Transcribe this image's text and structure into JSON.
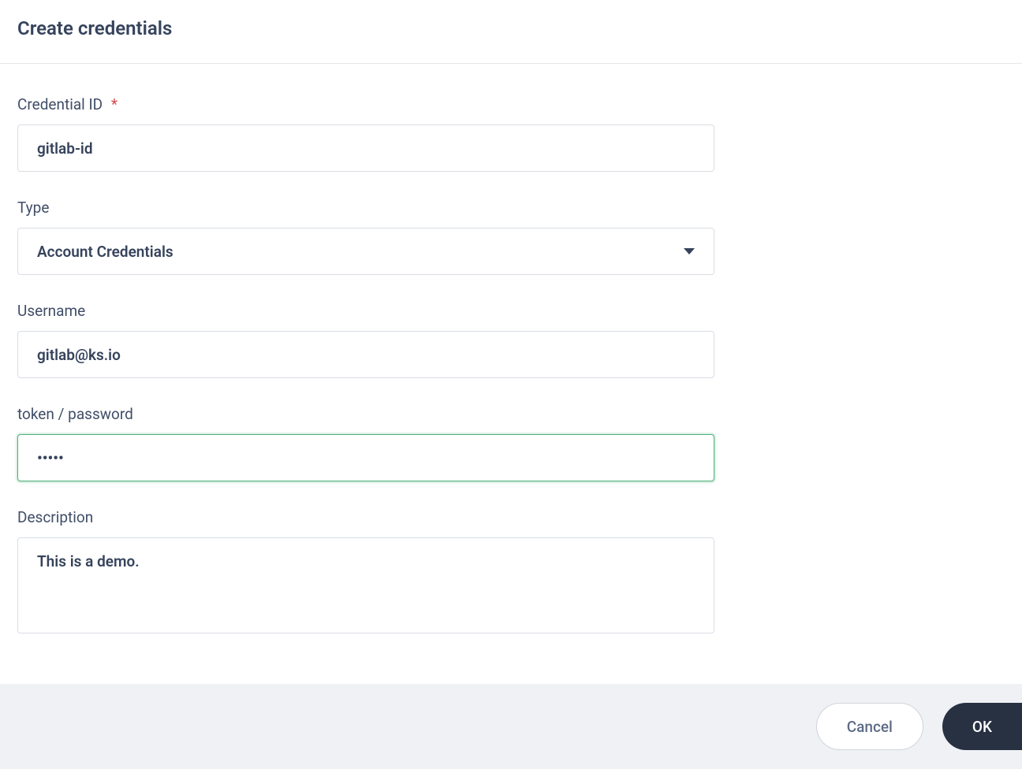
{
  "header": {
    "title": "Create credentials"
  },
  "form": {
    "credential_id": {
      "label": "Credential ID",
      "required_mark": "*",
      "value": "gitlab-id"
    },
    "type": {
      "label": "Type",
      "value": "Account Credentials"
    },
    "username": {
      "label": "Username",
      "value": "gitlab@ks.io"
    },
    "password": {
      "label": "token / password",
      "value": "•••••"
    },
    "description": {
      "label": "Description",
      "value": "This is a demo."
    }
  },
  "footer": {
    "cancel_label": "Cancel",
    "ok_label": "OK"
  }
}
